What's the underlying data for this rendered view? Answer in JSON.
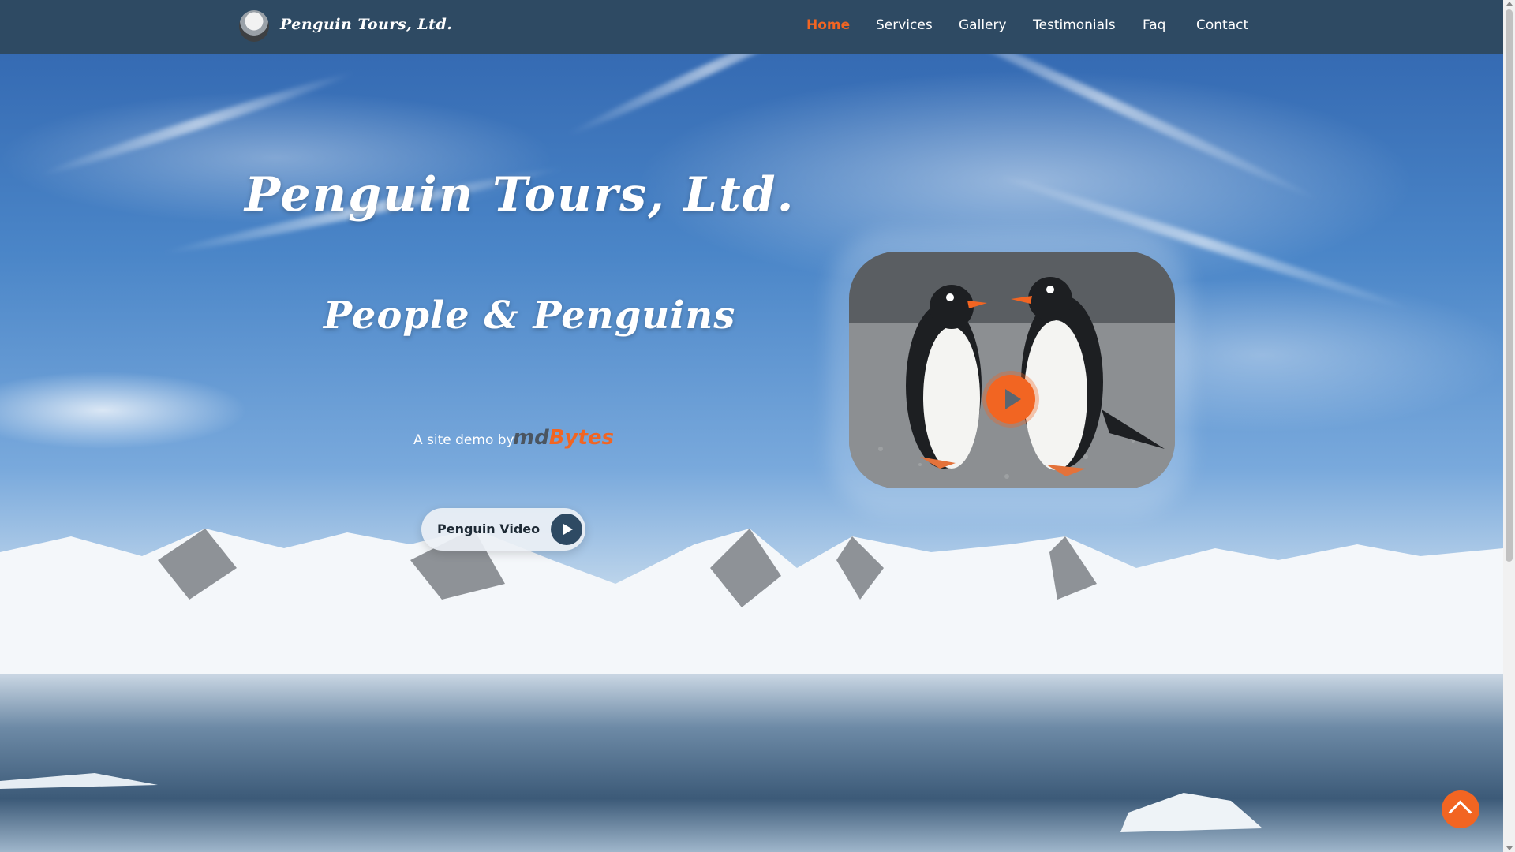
{
  "brand": {
    "name": "Penguin Tours, Ltd."
  },
  "nav": {
    "items": [
      "Home",
      "Services",
      "Gallery",
      "Testimonials",
      "Faq",
      "Contact"
    ],
    "active": "Home"
  },
  "hero": {
    "title": "Penguin Tours, Ltd.",
    "subtitle": "People & Penguins",
    "demo_text": "A site demo by",
    "demo_logo_md": "md",
    "demo_logo_bytes": "Bytes",
    "video_button_label": "Penguin Video"
  },
  "colors": {
    "accent": "#f26522",
    "navbar": "#2e4a63"
  },
  "icons": [
    "play-icon",
    "arrow-up-icon"
  ]
}
